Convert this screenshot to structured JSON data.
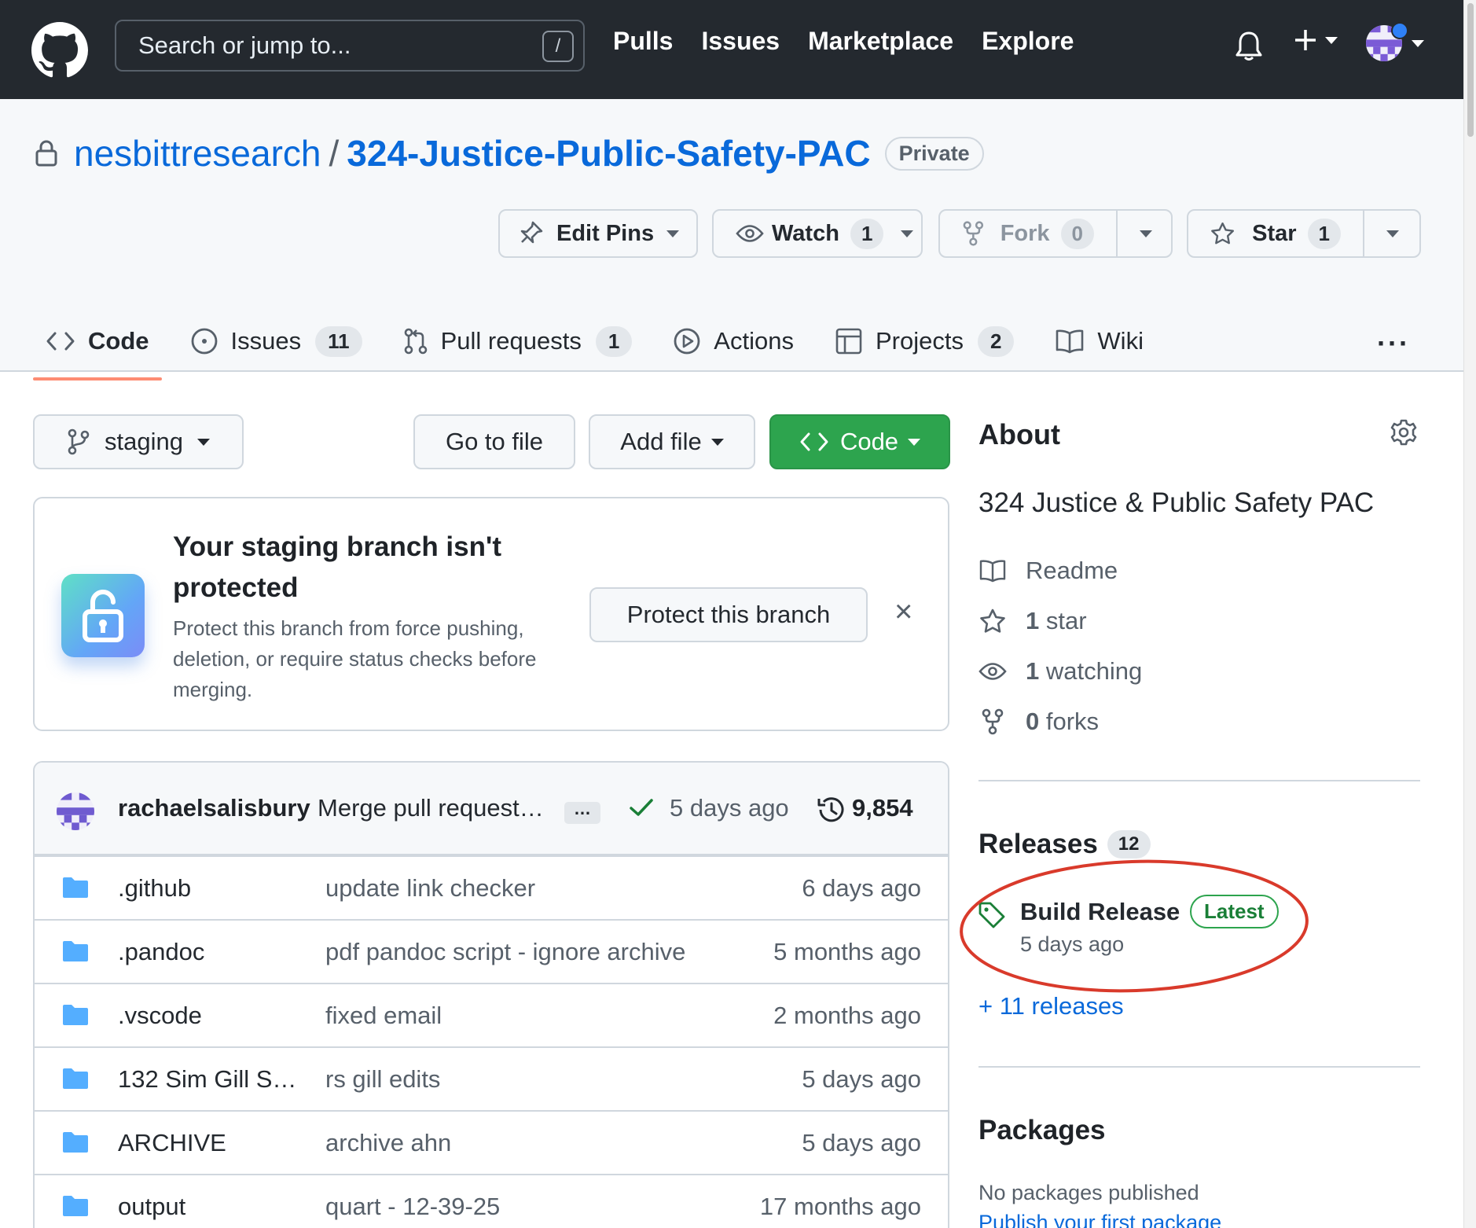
{
  "header": {
    "search_placeholder": "Search or jump to...",
    "search_shortcut": "/",
    "nav": [
      "Pulls",
      "Issues",
      "Marketplace",
      "Explore"
    ],
    "bg_color": "#24292f"
  },
  "repo": {
    "owner": "nesbittresearch",
    "separator": "/",
    "name": "324-Justice-Public-Safety-PAC",
    "visibility": "Private",
    "actions": {
      "edit_pins": "Edit Pins",
      "watch": "Watch",
      "watch_count": "1",
      "fork": "Fork",
      "fork_count": "0",
      "star": "Star",
      "star_count": "1"
    },
    "tabs": [
      {
        "label": "Code",
        "icon": "code-icon",
        "selected": true
      },
      {
        "label": "Issues",
        "icon": "issue-icon",
        "count": "11"
      },
      {
        "label": "Pull requests",
        "icon": "pull-request-icon",
        "count": "1"
      },
      {
        "label": "Actions",
        "icon": "play-icon"
      },
      {
        "label": "Projects",
        "icon": "table-icon",
        "count": "2"
      },
      {
        "label": "Wiki",
        "icon": "book-icon"
      }
    ],
    "more": "···"
  },
  "toolbar": {
    "branch": "staging",
    "go_to_file": "Go to file",
    "add_file": "Add file",
    "code": "Code",
    "code_color": "#2da44e"
  },
  "protect_banner": {
    "title": "Your staging branch isn't protected",
    "description": "Protect this branch from force pushing, deletion, or require status checks before merging.",
    "button": "Protect this branch",
    "close": "×"
  },
  "latest_commit": {
    "author": "rachaelsalisbury",
    "message": "Merge pull request…",
    "ellipsis": "…",
    "time": "5 days ago",
    "commit_count": "9,854"
  },
  "files": [
    {
      "name": ".github",
      "message": "update link checker",
      "time": "6 days ago"
    },
    {
      "name": ".pandoc",
      "message": "pdf pandoc script - ignore archive",
      "time": "5 months ago"
    },
    {
      "name": ".vscode",
      "message": "fixed email",
      "time": "2 months ago"
    },
    {
      "name": "132 Sim Gill S…",
      "message": "rs gill edits",
      "time": "5 days ago"
    },
    {
      "name": "ARCHIVE",
      "message": "archive ahn",
      "time": "5 days ago"
    },
    {
      "name": "output",
      "message": "quart - 12-39-25",
      "time": "17 months ago"
    }
  ],
  "about": {
    "heading": "About",
    "description": "324 Justice & Public Safety PAC",
    "readme": "Readme",
    "stars_count": "1",
    "stars_label": "star",
    "watching_count": "1",
    "watching_label": "watching",
    "forks_count": "0",
    "forks_label": "forks"
  },
  "releases": {
    "heading": "Releases",
    "count": "12",
    "latest_name": "Build Release",
    "latest_badge": "Latest",
    "latest_time": "5 days ago",
    "more_link": "+ 11 releases",
    "annotation_color": "#d93a2b"
  },
  "packages": {
    "heading": "Packages",
    "empty_text": "No packages published",
    "publish_link": "Publish your first package"
  }
}
